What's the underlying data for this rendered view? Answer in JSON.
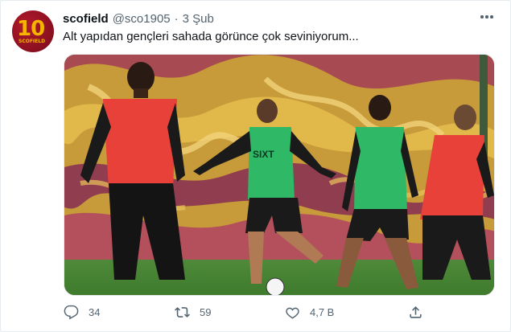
{
  "tweet": {
    "display_name": "scofield",
    "handle": "@sco1905",
    "separator": "·",
    "time": "3 Şub",
    "text": "Alt yapıdan gençleri sahada görünce çok seviniyorum...",
    "avatar": {
      "number": "10",
      "name": "SCOFIELD"
    },
    "media": {
      "sponsor_text": "SIXT"
    },
    "actions": {
      "replies": "34",
      "retweets": "59",
      "likes": "4,7 B"
    },
    "icons": {
      "reply": "reply-icon",
      "retweet": "retweet-icon",
      "like": "heart-icon",
      "share": "share-icon",
      "more": "more-icon"
    }
  }
}
